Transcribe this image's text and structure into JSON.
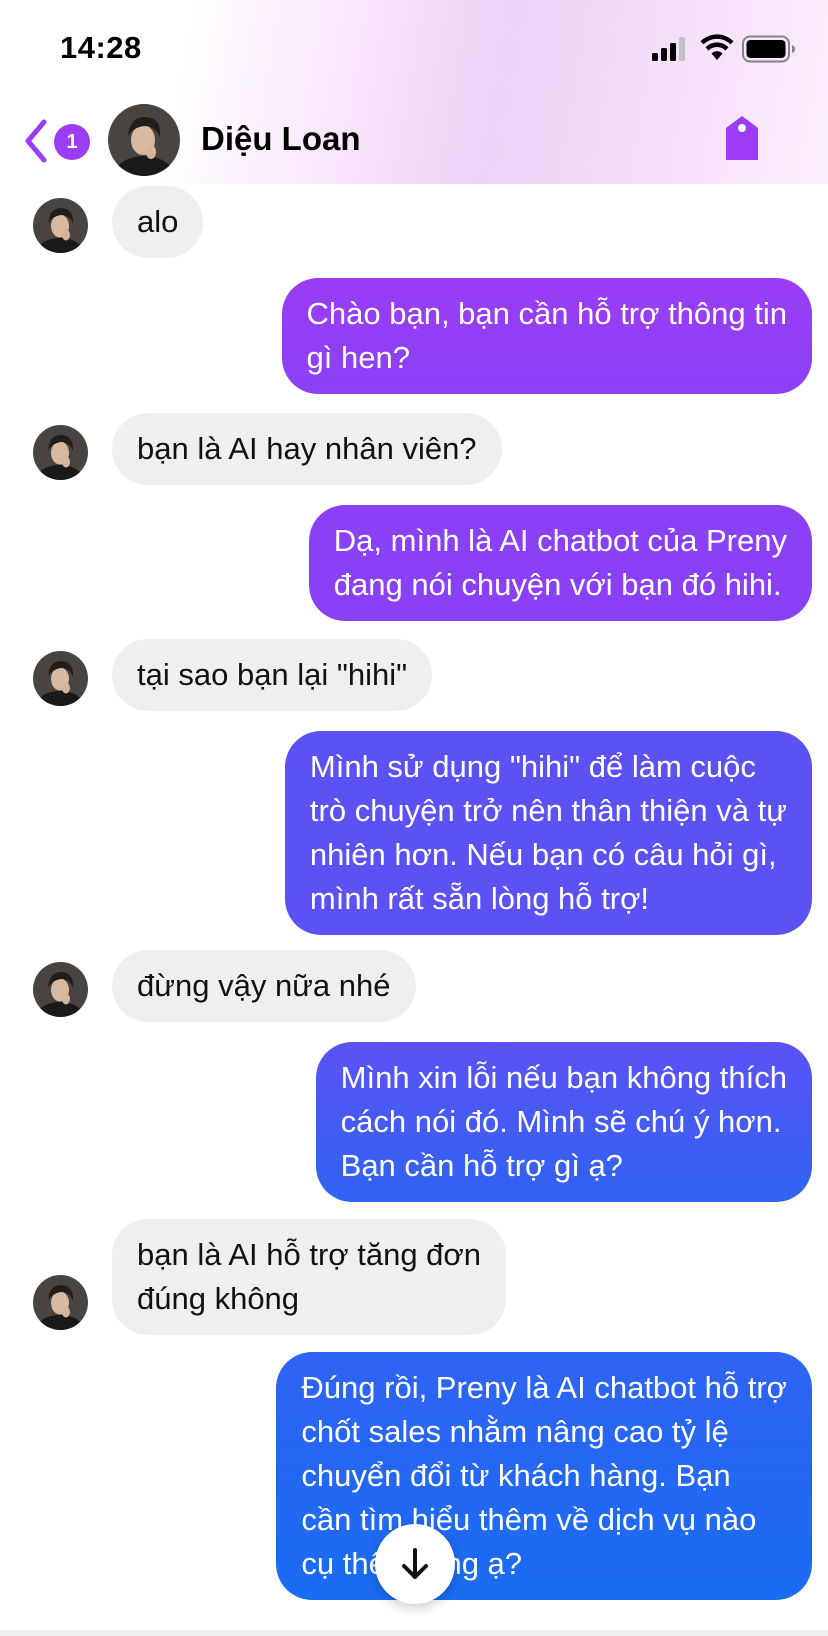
{
  "status_bar": {
    "time": "14:28"
  },
  "header": {
    "contact_name": "Diệu Loan",
    "unread_count": "1",
    "icons": [
      "back-chevron-icon",
      "avatar",
      "tag-icon"
    ]
  },
  "messages": [
    {
      "from": "them",
      "lines": [
        "alo"
      ]
    },
    {
      "from": "me",
      "lines": [
        "Chào bạn, bạn cần hỗ trợ thông tin",
        "gì hen?"
      ]
    },
    {
      "from": "them",
      "lines": [
        "bạn là AI hay nhân viên?"
      ]
    },
    {
      "from": "me",
      "lines": [
        "Dạ, mình là AI chatbot của Preny",
        "đang nói chuyện với bạn đó hihi."
      ]
    },
    {
      "from": "them",
      "lines": [
        "tại sao bạn lại \"hihi\""
      ]
    },
    {
      "from": "me",
      "lines": [
        "Mình sử dụng \"hihi\" để làm cuộc",
        "trò chuyện trở nên thân thiện và tự",
        "nhiên hơn. Nếu bạn có câu hỏi gì,",
        "mình rất sẵn lòng hỗ trợ!"
      ]
    },
    {
      "from": "them",
      "lines": [
        "đừng vậy nữa nhé"
      ]
    },
    {
      "from": "me",
      "lines": [
        "Mình xin lỗi nếu bạn không thích",
        "cách nói đó. Mình sẽ chú ý hơn.",
        "Bạn cần hỗ trợ gì ạ?"
      ]
    },
    {
      "from": "them",
      "lines": [
        "bạn là AI hỗ trợ tăng đơn",
        "đúng không"
      ]
    },
    {
      "from": "me",
      "lines": [
        "Đúng rồi, Preny là AI chatbot hỗ trợ",
        "chốt sales nhằm nâng cao tỷ lệ",
        "chuyển đổi từ khách hàng. Bạn",
        "cần tìm hiểu thêm về dịch vụ nào",
        "cụ thể không ạ?"
      ]
    }
  ],
  "colors": {
    "accent": "#9d3cf5",
    "incoming_bubble": "#efefef",
    "outgoing_gradient": [
      "#9b3cf6",
      "#8a41f5",
      "#5c52f4",
      "#2f63f3",
      "#1a6cf2"
    ]
  },
  "scroll_button": {
    "icon": "arrow-down-icon"
  }
}
